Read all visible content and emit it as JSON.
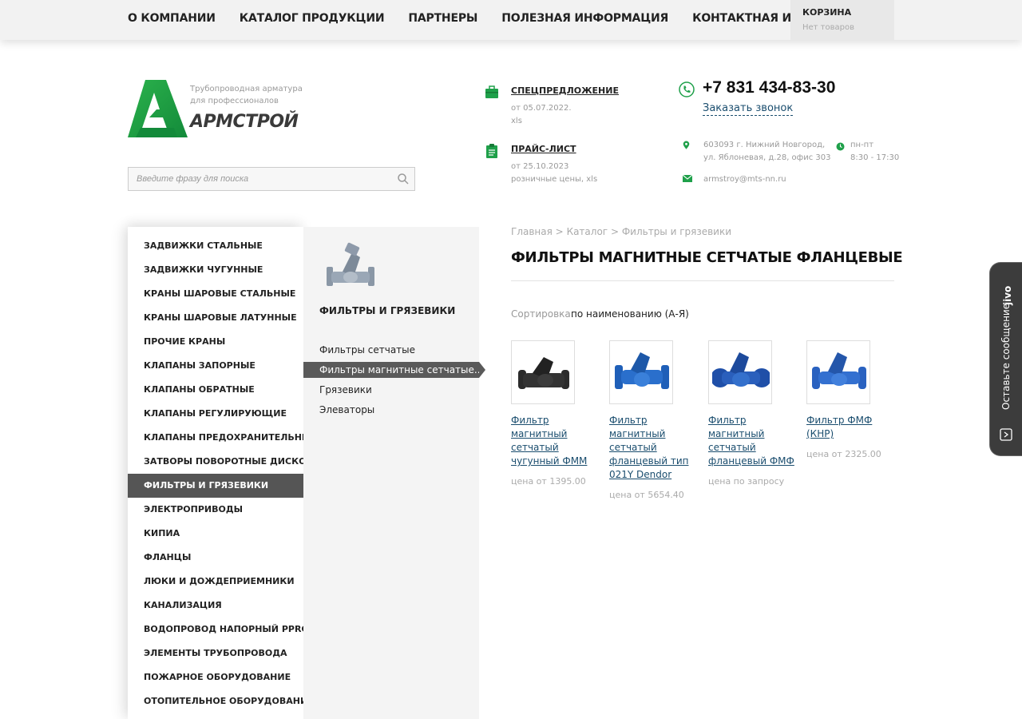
{
  "nav": {
    "items": [
      "О КОМПАНИИ",
      "КАТАЛОГ ПРОДУКЦИИ",
      "ПАРТНЕРЫ",
      "ПОЛЕЗНАЯ ИНФОРМАЦИЯ",
      "КОНТАКТНАЯ ИНФОРМАЦИЯ"
    ],
    "cart_title": "КОРЗИНА",
    "cart_status": "Нет товаров"
  },
  "header": {
    "tagline_1": "Трубопроводная арматура",
    "tagline_2": "для профессионалов",
    "brand": "АРМСТРОЙ",
    "search_placeholder": "Введите фразу для поиска",
    "promo_1": {
      "title": "СПЕЦПРЕДЛОЖЕНИЕ",
      "line1": "от 05.07.2022.",
      "line2": "xls"
    },
    "promo_2": {
      "title": "ПРАЙС-ЛИСТ",
      "line1": "от 25.10.2023",
      "line2": "розничные цены, xls"
    },
    "phone": "+7 831 434-83-30",
    "callback": "Заказать звонок",
    "address_1": "603093 г. Нижний Новгород,",
    "address_2": "ул. Яблоневая, д.28, офис 303",
    "hours_1": "пн-пт",
    "hours_2": "8:30 - 17:30",
    "email": "armstroy@mts-nn.ru",
    "accent": "#1fa04a"
  },
  "sidebar": {
    "items": [
      "ЗАДВИЖКИ СТАЛЬНЫЕ",
      "ЗАДВИЖКИ ЧУГУННЫЕ",
      "КРАНЫ ШАРОВЫЕ СТАЛЬНЫЕ",
      "КРАНЫ ШАРОВЫЕ ЛАТУННЫЕ",
      "ПРОЧИЕ КРАНЫ",
      "КЛАПАНЫ ЗАПОРНЫЕ",
      "КЛАПАНЫ ОБРАТНЫЕ",
      "КЛАПАНЫ РЕГУЛИРУЮЩИЕ",
      "КЛАПАНЫ ПРЕДОХРАНИТЕЛЬНЫЕ",
      "ЗАТВОРЫ ПОВОРОТНЫЕ ДИСКОВЫЕ",
      "ФИЛЬТРЫ И ГРЯЗЕВИКИ",
      "ЭЛЕКТРОПРИВОДЫ",
      "КИПиА",
      "ФЛАНЦЫ",
      "ЛЮКИ И ДОЖДЕПРИЕМНИКИ",
      "КАНАЛИЗАЦИЯ",
      "ВОДОПРОВОД НАПОРНЫЙ PPRC",
      "ЭЛЕМЕНТЫ ТРУБОПРОВОДА",
      "ПОЖАРНОЕ ОБОРУДОВАНИЕ",
      "ОТОПИТЕЛЬНОЕ ОБОРУДОВАНИЕ"
    ],
    "active_index": 10
  },
  "subpanel": {
    "title": "ФИЛЬТРЫ И ГРЯЗЕВИКИ",
    "items": [
      "Фильтры сетчатые",
      "Фильтры магнитные сетчатые...",
      "Грязевики",
      "Элеваторы"
    ],
    "active_index": 1
  },
  "main": {
    "breadcrumb": [
      "Главная",
      "Каталог",
      "Фильтры и грязевики"
    ],
    "breadcrumb_sep": ">",
    "title": "ФИЛЬТРЫ МАГНИТНЫЕ СЕТЧАТЫЕ ФЛАНЦЕВЫЕ",
    "sort_label": "Сортировка:",
    "sort_value": "по наименованию (А-Я)",
    "products": [
      {
        "name": "Фильтр магнитный сетчатый чугунный ФММ",
        "price": "цена от 1395.00",
        "color": "#2b2b2b"
      },
      {
        "name": "Фильтр магнитный сетчатый фланцевый тип 021Y Dendor",
        "price": "цена от 5654.40",
        "color": "#1f5fb8"
      },
      {
        "name": "Фильтр магнитный сетчатый фланцевый ФМФ",
        "price": "цена по запросу",
        "color": "#1f4fa8"
      },
      {
        "name": "Фильтр ФМФ (КНР)",
        "price": "цена от 2325.00",
        "color": "#2a62c0"
      }
    ]
  },
  "jivo": {
    "brand": "jivo",
    "label": "Оставьте сообщение"
  }
}
